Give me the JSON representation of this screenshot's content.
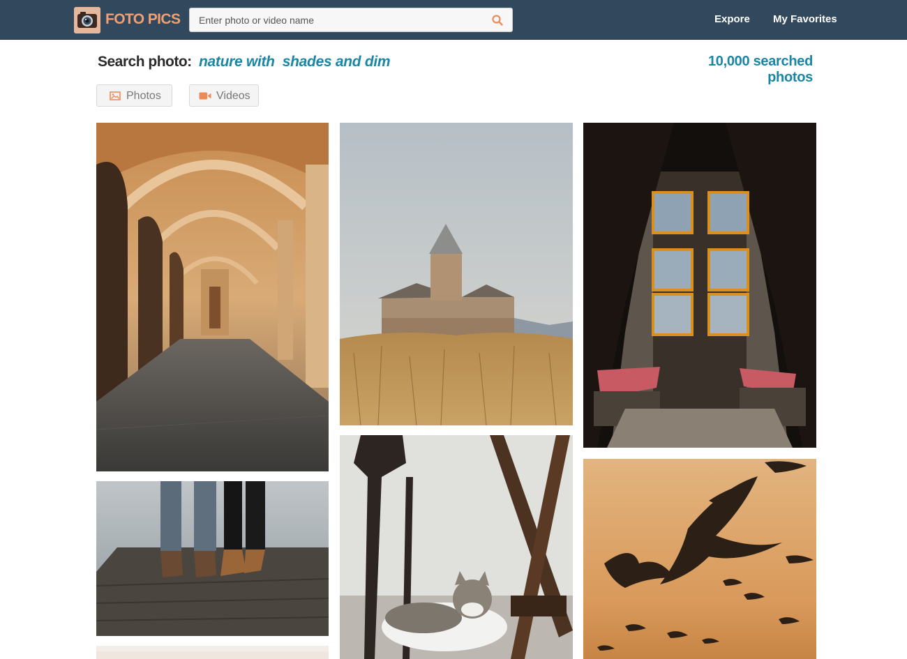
{
  "brand": {
    "name": "FOTO PICS",
    "logo_icon": "camera-icon"
  },
  "search": {
    "placeholder": "Enter photo or video name",
    "value": "",
    "icon": "search-icon"
  },
  "nav": {
    "explore_label": "Expore",
    "favorites_label": "My Favorites"
  },
  "results": {
    "heading": "Search photo:",
    "query": "nature with  shades and dim",
    "count_text": "10,000 searched photos"
  },
  "tabs": [
    {
      "label": "Photos",
      "icon": "image-icon"
    },
    {
      "label": "Videos",
      "icon": "video-camera-icon"
    }
  ],
  "photos": [
    {
      "subject": "arched-corridor"
    },
    {
      "subject": "two-people-boots-on-dock"
    },
    {
      "subject": "partial-photo"
    },
    {
      "subject": "church-in-wheat-field"
    },
    {
      "subject": "cat-by-wall"
    },
    {
      "subject": "stained-glass-window-alcove"
    },
    {
      "subject": "seagulls-at-sunset"
    }
  ],
  "colors": {
    "topbar": "#32495d",
    "brand_orange": "#f0a074",
    "accent_teal": "#1a86a4",
    "tab_icon_orange": "#ee8a5a"
  }
}
